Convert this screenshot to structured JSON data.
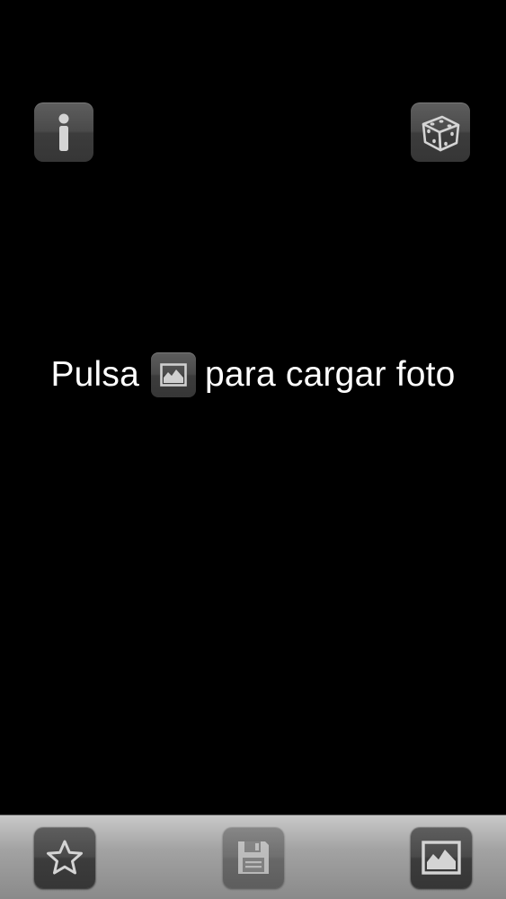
{
  "top_bar": {
    "info_icon": "info-icon",
    "random_icon": "dice-icon"
  },
  "prompt": {
    "before": "Pulsa",
    "icon": "photo-icon",
    "after": "para cargar foto"
  },
  "toolbar": {
    "items": [
      {
        "icon": "star-icon",
        "enabled": true
      },
      {
        "icon": "floppy-disk-icon",
        "enabled": false
      },
      {
        "icon": "photo-icon",
        "enabled": true
      }
    ]
  },
  "colors": {
    "background": "#000000",
    "tile": "#4a4a4a",
    "icon": "#d0d0d0",
    "text": "#ffffff",
    "toolbar": "#a3a3a3"
  }
}
